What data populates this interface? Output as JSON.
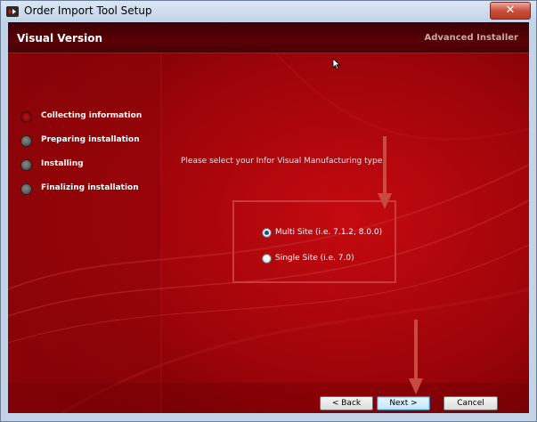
{
  "window": {
    "title": "Order Import Tool Setup",
    "close_label": "✕"
  },
  "header": {
    "title": "Visual Version",
    "brand": "Advanced Installer"
  },
  "steps": [
    {
      "label": "Collecting information",
      "state": "active"
    },
    {
      "label": "Preparing installation",
      "state": "pending"
    },
    {
      "label": "Installing",
      "state": "pending"
    },
    {
      "label": "Finalizing installation",
      "state": "pending"
    }
  ],
  "main": {
    "prompt": "Please select your Infor Visual Manufacturing type:",
    "options": [
      {
        "label": "Multi Site (i.e. 7.1.2, 8.0.0)",
        "checked": true
      },
      {
        "label": "Single Site (i.e. 7.0)",
        "checked": false
      }
    ]
  },
  "footer": {
    "back_label": "< Back",
    "next_label": "Next >",
    "cancel_label": "Cancel"
  },
  "colors": {
    "background_red": "#8a0206",
    "header_dark": "#470004",
    "annotation_red": "#c93a3a",
    "active_step": "#b7181c"
  },
  "icons": {
    "app": "installer-app-icon",
    "close": "close-icon",
    "cursor": "mouse-pointer-icon"
  }
}
